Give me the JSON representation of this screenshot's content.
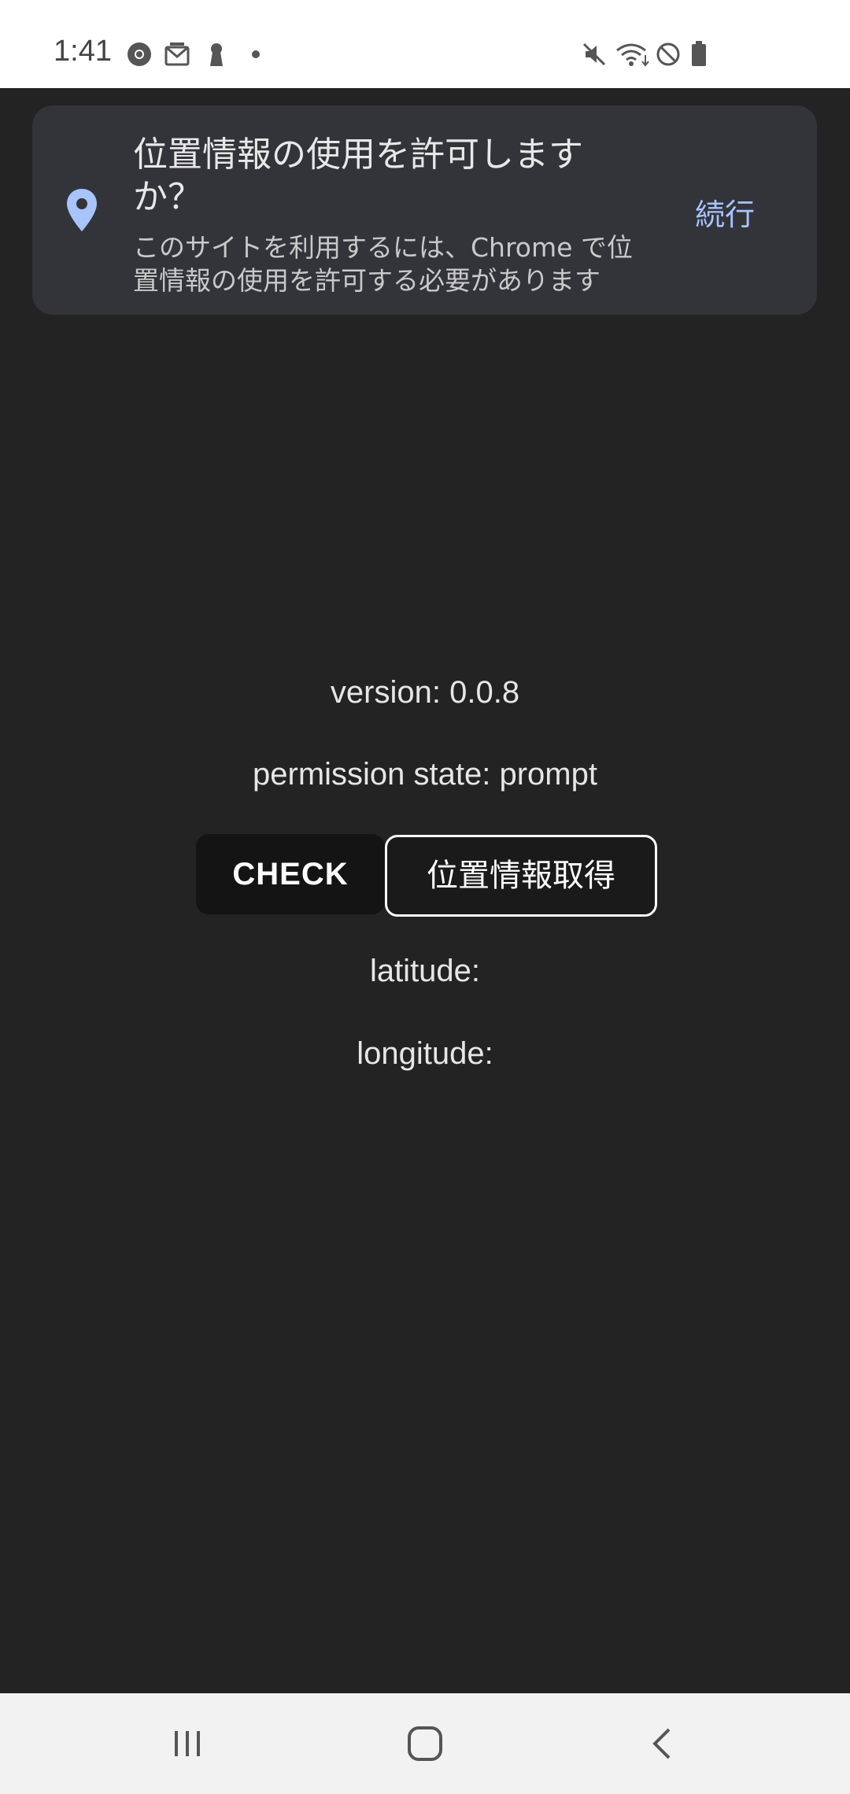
{
  "status_bar": {
    "time": "1:41",
    "left_icons": [
      "chrome-icon",
      "cast-icon",
      "keyhole-icon",
      "dot-icon"
    ],
    "right_icons": [
      "mute-icon",
      "wifi-icon",
      "dnd-icon",
      "battery-icon"
    ]
  },
  "permission_prompt": {
    "title": "位置情報の使用を許可しますか？",
    "description": "このサイトを利用するには、Chrome で位置情報の使用を許可する必要があります",
    "action_label": "続行",
    "icon": "location-pin-icon",
    "accent_color": "#a7c4ff"
  },
  "page": {
    "version_text": "version: 0.0.8",
    "permission_state_text": "permission state: prompt",
    "check_button_label": "CHECK",
    "get_location_button_label": "位置情報取得",
    "latitude_label": "latitude:",
    "longitude_label": "longitude:"
  },
  "nav_bar": {
    "buttons": [
      "recents-icon",
      "home-icon",
      "back-icon"
    ]
  }
}
